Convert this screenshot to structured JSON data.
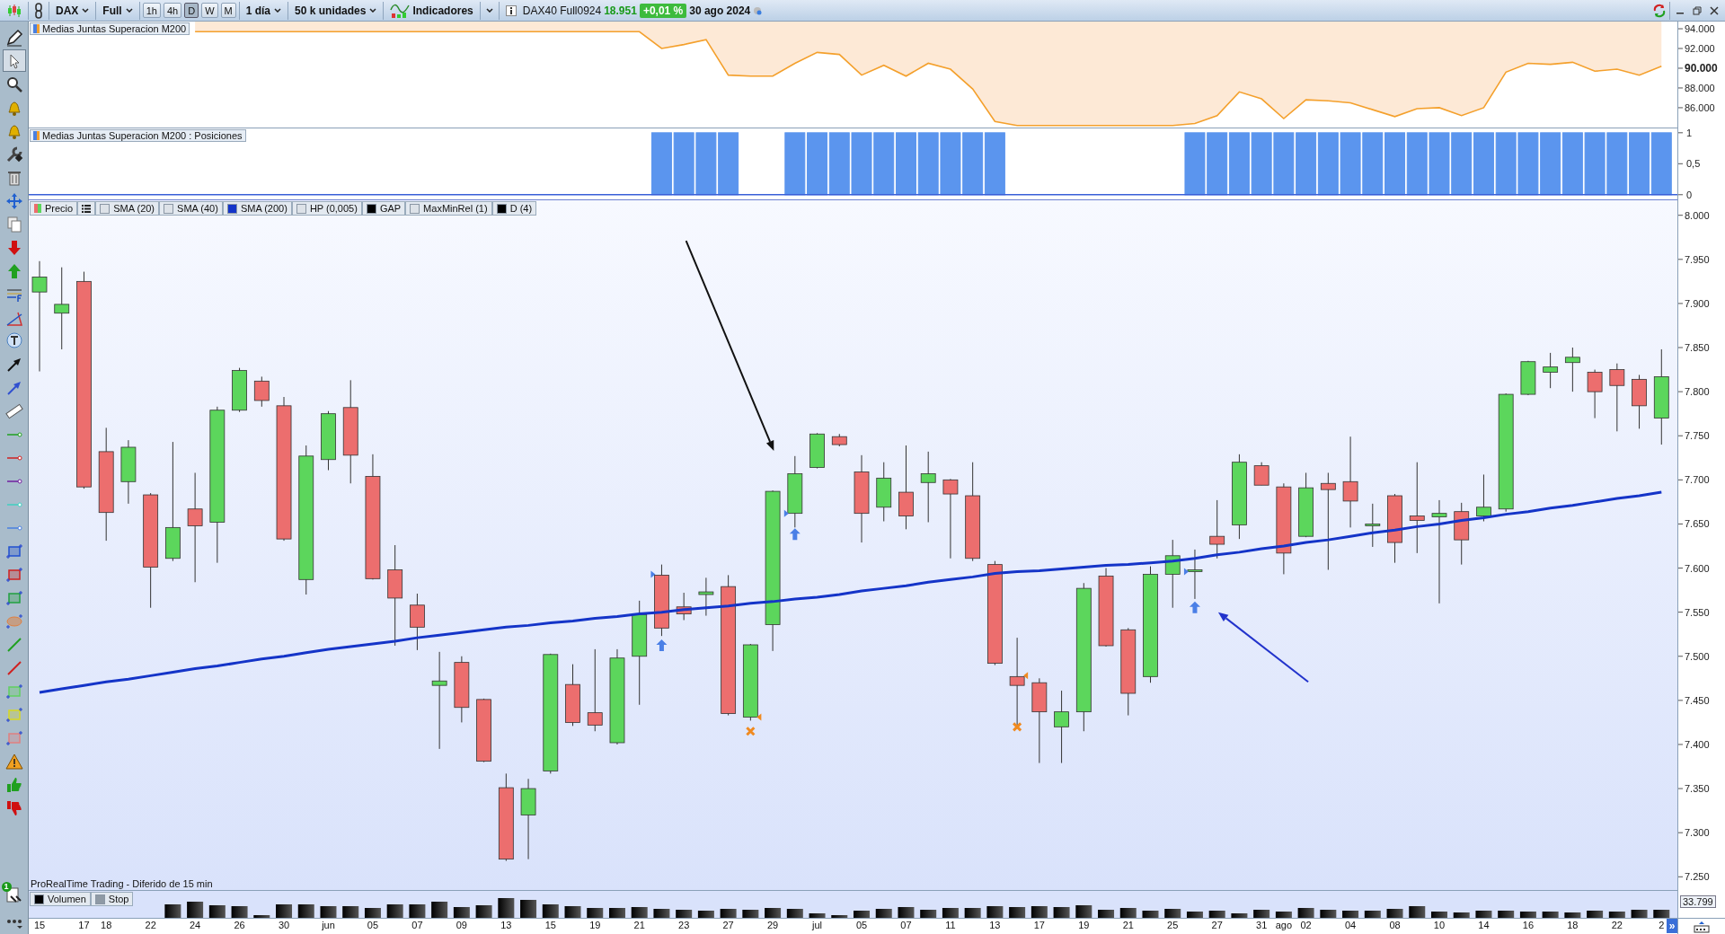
{
  "toolbar": {
    "instrument": "DAX",
    "range": "Full",
    "timeframes": [
      {
        "label": "1h",
        "selected": false
      },
      {
        "label": "4h",
        "selected": false
      },
      {
        "label": "D",
        "selected": true
      },
      {
        "label": "W",
        "selected": false
      },
      {
        "label": "M",
        "selected": false
      }
    ],
    "interval": "1 día",
    "units": "50 k unidades",
    "indicators": "Indicadores",
    "symbol": "DAX40 Full0924",
    "price": "18.951",
    "change": "+0,01 %",
    "date": "30 ago 2024"
  },
  "tools": [
    {
      "selected": false
    },
    {
      "selected": true
    },
    {
      "selected": false
    },
    {
      "selected": false
    },
    {
      "selected": false
    },
    {
      "selected": false
    },
    {
      "selected": false
    },
    {
      "selected": false
    },
    {
      "selected": false
    },
    {
      "selected": false
    },
    {
      "selected": false
    },
    {
      "selected": false
    },
    {
      "selected": false
    },
    {
      "selected": false
    },
    {
      "selected": false
    },
    {
      "selected": false
    },
    {
      "selected": false
    },
    {
      "selected": false
    },
    {
      "selected": false
    },
    {
      "selected": false
    },
    {
      "selected": false
    },
    {
      "selected": false
    },
    {
      "selected": false
    },
    {
      "selected": false
    },
    {
      "selected": false
    },
    {
      "selected": false
    },
    {
      "selected": false
    },
    {
      "selected": false
    },
    {
      "selected": false
    },
    {
      "selected": false
    },
    {
      "selected": false
    },
    {
      "selected": false
    },
    {
      "selected": false
    },
    {
      "selected": false
    }
  ],
  "tools_badge": "1",
  "indicator_panel": {
    "title": "Medias Juntas Superacion M200",
    "chart_data": {
      "type": "line",
      "ylim": [
        83900,
        94730
      ],
      "yticks": [
        {
          "value": 86000,
          "label": "86.000"
        },
        {
          "value": 88000,
          "label": "88.000"
        },
        {
          "value": 90000,
          "label": "90.000"
        },
        {
          "value": 92000,
          "label": "92.000"
        },
        {
          "value": 94000,
          "label": "94.000"
        }
      ],
      "series": [
        {
          "color": "#f4a02c",
          "values": [
            null,
            null,
            null,
            null,
            null,
            null,
            null,
            93700,
            93700,
            93700,
            93700,
            93700,
            93700,
            93700,
            93700,
            93700,
            93700,
            93700,
            93700,
            93700,
            93700,
            93700,
            93700,
            93700,
            93700,
            93700,
            93700,
            93700,
            92000,
            92400,
            92900,
            89300,
            89200,
            89200,
            90500,
            91600,
            91400,
            89300,
            90300,
            89200,
            90500,
            89900,
            87900,
            84600,
            84200,
            84200,
            84200,
            84200,
            84200,
            84200,
            84200,
            84200,
            84400,
            85200,
            87600,
            86900,
            84900,
            86800,
            86700,
            86500,
            85800,
            85100,
            85900,
            86000,
            85200,
            86000,
            89600,
            90500,
            90400,
            90600,
            89700,
            89900,
            89300,
            90200
          ]
        }
      ]
    }
  },
  "positions_panel": {
    "title": "Medias Juntas Superacion M200 : Posiciones",
    "chart_data": {
      "type": "bar",
      "ylim": [
        -0.09,
        1.07
      ],
      "yticks": [
        {
          "value": 0,
          "label": "0"
        },
        {
          "value": 0.5,
          "label": "0,5"
        },
        {
          "value": 1,
          "label": "1"
        }
      ],
      "series": [
        {
          "color": "#5b95ee",
          "values": [
            0,
            0,
            0,
            0,
            0,
            0,
            0,
            0,
            0,
            0,
            0,
            0,
            0,
            0,
            0,
            0,
            0,
            0,
            0,
            0,
            0,
            0,
            0,
            0,
            0,
            0,
            0,
            0,
            1,
            1,
            1,
            1,
            0,
            0,
            1,
            1,
            1,
            1,
            1,
            1,
            1,
            1,
            1,
            1,
            0,
            0,
            0,
            0,
            0,
            0,
            0,
            0,
            1,
            1,
            1,
            1,
            1,
            1,
            1,
            1,
            1,
            1,
            1,
            1,
            1,
            1,
            1,
            1,
            1,
            1,
            1,
            1,
            1,
            1
          ]
        }
      ]
    }
  },
  "price_panel": {
    "legend": [
      {
        "label": "Precio",
        "kind": "price"
      },
      {
        "kind": "menu"
      },
      {
        "label": "SMA (20)",
        "kind": "swatch",
        "color": "#dde2e8"
      },
      {
        "label": "SMA (40)",
        "kind": "swatch",
        "color": "#dde2e8"
      },
      {
        "label": "SMA (200)",
        "kind": "swatch",
        "color": "#1434c8"
      },
      {
        "label": "HP (0,005)",
        "kind": "swatch",
        "color": "#dde2e8"
      },
      {
        "label": "GAP",
        "kind": "swatch",
        "color": "#000000"
      },
      {
        "label": "MaxMinRel (1)",
        "kind": "swatch",
        "color": "#dde2e8"
      },
      {
        "label": "D (4)",
        "kind": "swatch",
        "color": "#000000"
      }
    ],
    "footer": "ProRealTime Trading - Diferido de 15 min",
    "chart_data": {
      "type": "candlestick",
      "ylim": [
        7234,
        8017
      ],
      "categories": [
        "15",
        null,
        "17",
        "18",
        null,
        "22",
        null,
        "24",
        null,
        "26",
        null,
        "30",
        null,
        "jun",
        null,
        "05",
        null,
        "07",
        null,
        "09",
        null,
        "13",
        null,
        "15",
        null,
        "19",
        null,
        "21",
        null,
        "23",
        null,
        "27",
        null,
        "29",
        null,
        "jul",
        null,
        "05",
        null,
        "07",
        null,
        "11",
        null,
        "13",
        null,
        "17",
        null,
        "19",
        null,
        "21",
        null,
        "25",
        null,
        "27",
        null,
        "31",
        "ago",
        "02",
        null,
        "04",
        null,
        "08",
        null,
        "10",
        null,
        "14",
        null,
        "16",
        null,
        "18",
        null,
        "22",
        null,
        "2"
      ],
      "yticks": [
        {
          "value": 7250,
          "label": "7.250"
        },
        {
          "value": 7300,
          "label": "7.300"
        },
        {
          "value": 7350,
          "label": "7.350"
        },
        {
          "value": 7400,
          "label": "7.400"
        },
        {
          "value": 7450,
          "label": "7.450"
        },
        {
          "value": 7500,
          "label": "7.500"
        },
        {
          "value": 7550,
          "label": "7.550"
        },
        {
          "value": 7600,
          "label": "7.600"
        },
        {
          "value": 7650,
          "label": "7.650"
        },
        {
          "value": 7700,
          "label": "7.700"
        },
        {
          "value": 7750,
          "label": "7.750"
        },
        {
          "value": 7800,
          "label": "7.800"
        },
        {
          "value": 7850,
          "label": "7.850"
        },
        {
          "value": 7900,
          "label": "7.900"
        },
        {
          "value": 7950,
          "label": "7.950"
        },
        {
          "value": 8000,
          "label": "8.000"
        }
      ],
      "ohlc": [
        [
          7913,
          7948,
          7823,
          7930
        ],
        [
          7889,
          7941,
          7848,
          7899
        ],
        [
          7925,
          7936,
          7690,
          7692
        ],
        [
          7732,
          7759,
          7631,
          7663
        ],
        [
          7698,
          7745,
          7673,
          7737
        ],
        [
          7683,
          7685,
          7555,
          7601
        ],
        [
          7611,
          7743,
          7608,
          7646
        ],
        [
          7667,
          7708,
          7584,
          7648
        ],
        [
          7652,
          7783,
          7606,
          7779
        ],
        [
          7779,
          7827,
          7777,
          7824
        ],
        [
          7812,
          7817,
          7783,
          7790
        ],
        [
          7784,
          7794,
          7631,
          7633
        ],
        [
          7587,
          7739,
          7570,
          7727
        ],
        [
          7723,
          7778,
          7711,
          7775
        ],
        [
          7782,
          7813,
          7696,
          7728
        ],
        [
          7704,
          7729,
          7587,
          7588
        ],
        [
          7598,
          7626,
          7512,
          7566
        ],
        [
          7558,
          7571,
          7507,
          7533
        ],
        [
          7467,
          7505,
          7395,
          7472
        ],
        [
          7493,
          7500,
          7425,
          7442
        ],
        [
          7451,
          7452,
          7380,
          7381
        ],
        [
          7351,
          7367,
          7268,
          7270
        ],
        [
          7320,
          7361,
          7270,
          7350
        ],
        [
          7370,
          7503,
          7367,
          7502
        ],
        [
          7468,
          7491,
          7421,
          7425
        ],
        [
          7436,
          7508,
          7415,
          7422
        ],
        [
          7402,
          7508,
          7400,
          7498
        ],
        [
          7500,
          7563,
          7445,
          7547
        ],
        [
          7592,
          7604,
          7523,
          7532
        ],
        [
          7556,
          7572,
          7541,
          7548
        ],
        [
          7570,
          7589,
          7546,
          7573
        ],
        [
          7579,
          7592,
          7433,
          7435
        ],
        [
          7431,
          7514,
          7427,
          7513
        ],
        [
          7536,
          7688,
          7506,
          7687
        ],
        [
          7662,
          7727,
          7646,
          7707
        ],
        [
          7714,
          7753,
          7713,
          7752
        ],
        [
          7749,
          7752,
          7738,
          7740
        ],
        [
          7709,
          7728,
          7629,
          7662
        ],
        [
          7669,
          7720,
          7653,
          7702
        ],
        [
          7686,
          7739,
          7644,
          7659
        ],
        [
          7697,
          7732,
          7652,
          7707
        ],
        [
          7700,
          7701,
          7611,
          7684
        ],
        [
          7682,
          7720,
          7608,
          7611
        ],
        [
          7604,
          7608,
          7490,
          7492
        ],
        [
          7477,
          7521,
          7421,
          7467
        ],
        [
          7470,
          7475,
          7379,
          7437
        ],
        [
          7420,
          7461,
          7379,
          7437
        ],
        [
          7437,
          7583,
          7415,
          7577
        ],
        [
          7591,
          7600,
          7511,
          7512
        ],
        [
          7530,
          7532,
          7433,
          7458
        ],
        [
          7477,
          7602,
          7470,
          7593
        ],
        [
          7593,
          7632,
          7555,
          7614
        ],
        [
          7597,
          7621,
          7565,
          7598
        ],
        [
          7636,
          7677,
          7611,
          7627
        ],
        [
          7649,
          7729,
          7633,
          7720
        ],
        [
          7716,
          7720,
          7694,
          7694
        ],
        [
          7692,
          7696,
          7593,
          7617
        ],
        [
          7636,
          7708,
          7635,
          7691
        ],
        [
          7696,
          7708,
          7598,
          7689
        ],
        [
          7698,
          7749,
          7646,
          7676
        ],
        [
          7649,
          7673,
          7624,
          7650
        ],
        [
          7682,
          7684,
          7606,
          7629
        ],
        [
          7659,
          7720,
          7617,
          7654
        ],
        [
          7658,
          7677,
          7560,
          7662
        ],
        [
          7664,
          7674,
          7604,
          7632
        ],
        [
          7659,
          7706,
          7653,
          7669
        ],
        [
          7667,
          7798,
          7664,
          7797
        ],
        [
          7797,
          7835,
          7796,
          7834
        ],
        [
          7822,
          7844,
          7804,
          7828
        ],
        [
          7833,
          7850,
          7800,
          7839
        ],
        [
          7822,
          7825,
          7770,
          7800
        ],
        [
          7825,
          7832,
          7755,
          7807
        ],
        [
          7814,
          7819,
          7758,
          7784
        ],
        [
          7770,
          7848,
          7740,
          7817
        ]
      ]
    }
  },
  "volume_panel": {
    "legend": [
      {
        "label": "Volumen",
        "color": "#000000"
      },
      {
        "label": "Stop",
        "color": "#8f9aa5"
      }
    ],
    "reading": "33.799"
  },
  "scroll_button": "»"
}
